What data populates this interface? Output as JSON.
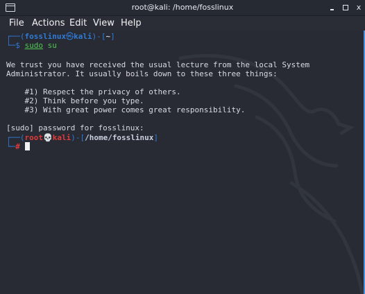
{
  "window": {
    "title": "root@kali: /home/fosslinux",
    "minimize_label": "_",
    "maximize_label": "",
    "close_label": "x"
  },
  "menu": {
    "file": "File",
    "actions": "Actions",
    "edit": "Edit",
    "view": "View",
    "help": "Help"
  },
  "terminal": {
    "prompt1": {
      "open": "┌──(",
      "user": "fosslinux",
      "at": "㉿",
      "host": "kali",
      "close": ")-[",
      "dir": "~",
      "end": "]"
    },
    "prompt1_cmd": {
      "lead": "└─$ ",
      "command": "sudo",
      "args": " su"
    },
    "lecture": [
      "We trust you have received the usual lecture from the local System",
      "Administrator. It usually boils down to these three things:",
      "",
      "    #1) Respect the privacy of others.",
      "    #2) Think before you type.",
      "    #3) With great power comes great responsibility.",
      "",
      "[sudo] password for fosslinux:"
    ],
    "prompt2": {
      "open": "┌──(",
      "user": "root",
      "skull": "💀",
      "host": "kali",
      "close": ")-[",
      "dir": "/home/fosslinux",
      "end": "]"
    },
    "prompt2_cmd": {
      "lead": "└─",
      "symbol": "#"
    }
  },
  "colors": {
    "background": "#282b33",
    "user_prompt": "#2f7bd8",
    "root_prompt": "#e03a3a",
    "command": "#4fc94f"
  }
}
